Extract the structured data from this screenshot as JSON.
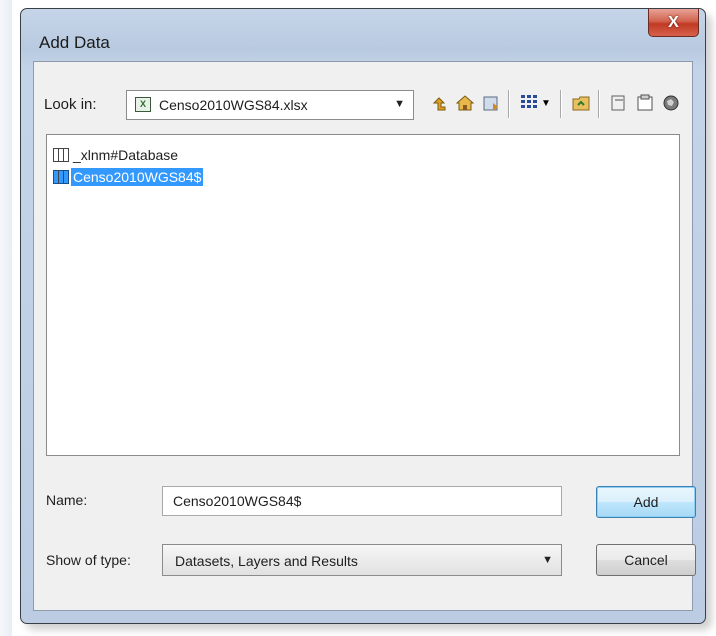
{
  "dialog": {
    "title": "Add Data",
    "close_glyph": "X"
  },
  "lookin": {
    "label": "Look in:",
    "value": "Censo2010WGS84.xlsx"
  },
  "toolbar": {
    "icons": [
      "up-one-level-icon",
      "home-icon",
      "connect-folder-icon",
      "view-toggle-icon",
      "new-folder-icon",
      "copy-icon",
      "catalog-icon",
      "search-icon"
    ]
  },
  "file_list": {
    "items": [
      {
        "label": "_xlnm#Database",
        "selected": false
      },
      {
        "label": "Censo2010WGS84$",
        "selected": true
      }
    ]
  },
  "name_field": {
    "label": "Name:",
    "value": "Censo2010WGS84$"
  },
  "type_field": {
    "label": "Show of type:",
    "value": "Datasets, Layers and Results"
  },
  "buttons": {
    "add": "Add",
    "cancel": "Cancel"
  }
}
